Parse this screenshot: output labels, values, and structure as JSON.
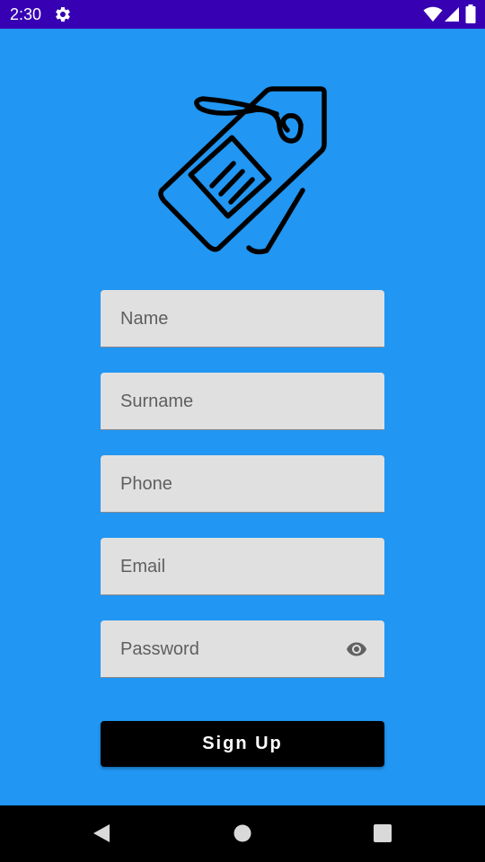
{
  "status_bar": {
    "time": "2:30",
    "icons": [
      "settings-icon",
      "wifi-icon",
      "signal-icon",
      "battery-icon"
    ]
  },
  "logo": {
    "icon": "price-tag-icon"
  },
  "form": {
    "name": {
      "placeholder": "Name"
    },
    "surname": {
      "placeholder": "Surname"
    },
    "phone": {
      "placeholder": "Phone"
    },
    "email": {
      "placeholder": "Email"
    },
    "password": {
      "placeholder": "Password",
      "toggle_icon": "eye-icon"
    },
    "submit_label": "Sign Up"
  },
  "nav_bar": {
    "icons": [
      "back-icon",
      "home-icon",
      "recents-icon"
    ]
  },
  "colors": {
    "status_bar": "#3700B3",
    "background": "#2196F3",
    "field_background": "#E0E0E0",
    "button_background": "#000000",
    "button_text": "#FFFFFF"
  }
}
